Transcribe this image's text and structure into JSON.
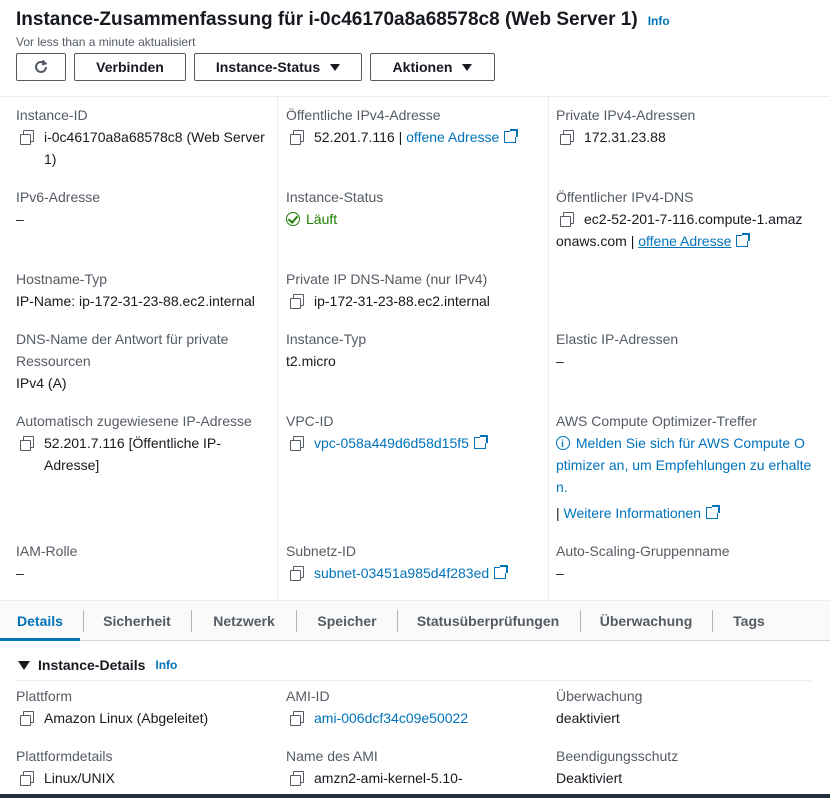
{
  "header": {
    "title": "Instance-Zusammenfassung für i-0c46170a8a68578c8 (Web Server 1)",
    "info": "Info",
    "subtitle": "Vor less than a minute aktualisiert",
    "buttons": {
      "connect": "Verbinden",
      "status": "Instance-Status",
      "actions": "Aktionen"
    }
  },
  "summary": {
    "instance_id": {
      "label": "Instance-ID",
      "value": "i-0c46170a8a68578c8 (Web Server 1)"
    },
    "public_ipv4": {
      "label": "Öffentliche IPv4-Adresse",
      "value": "52.201.7.116",
      "sep": " | ",
      "link": "offene Adresse"
    },
    "private_ipv4": {
      "label": "Private IPv4-Adressen",
      "value": "172.31.23.88"
    },
    "ipv6": {
      "label": "IPv6-Adresse",
      "value": "–"
    },
    "instance_state": {
      "label": "Instance-Status",
      "value": "Läuft"
    },
    "public_dns": {
      "label": "Öffentlicher IPv4-DNS",
      "value": "ec2-52-201-7-116.compute-1.amazonaws.com",
      "sep": " | ",
      "link": "offene Adresse"
    },
    "hostname_type": {
      "label": "Hostname-Typ",
      "value": "IP-Name: ip-172-31-23-88.ec2.internal"
    },
    "private_dns": {
      "label": "Private IP DNS-Name (nur IPv4)",
      "value": "ip-172-31-23-88.ec2.internal"
    },
    "answer_dns": {
      "label": "DNS-Name der Antwort für private Ressourcen",
      "value": "IPv4 (A)"
    },
    "instance_type": {
      "label": "Instance-Typ",
      "value": "t2.micro"
    },
    "elastic_ip": {
      "label": "Elastic IP-Adressen",
      "value": "–"
    },
    "auto_ip": {
      "label": "Automatisch zugewiesene IP-Adresse",
      "value": "52.201.7.116 [Öffentliche IP-Adresse]"
    },
    "vpc": {
      "label": "VPC-ID",
      "value": "vpc-058a449d6d58d15f5"
    },
    "optimizer": {
      "label": "AWS Compute Optimizer-Treffer",
      "value": "Melden Sie sich für AWS Compute Optimizer an, um Empfehlungen zu erhalten.",
      "sep": "| ",
      "link": "Weitere Informationen"
    },
    "iam": {
      "label": "IAM-Rolle",
      "value": "–"
    },
    "subnet": {
      "label": "Subnetz-ID",
      "value": "subnet-03451a985d4f283ed"
    },
    "asg": {
      "label": "Auto-Scaling-Gruppenname",
      "value": "–"
    }
  },
  "tabs": [
    "Details",
    "Sicherheit",
    "Netzwerk",
    "Speicher",
    "Statusüberprüfungen",
    "Überwachung",
    "Tags"
  ],
  "details": {
    "section_title": "Instance-Details",
    "info": "Info",
    "platform": {
      "label": "Plattform",
      "value": "Amazon Linux (Abgeleitet)"
    },
    "ami_id": {
      "label": "AMI-ID",
      "value": "ami-006dcf34c09e50022"
    },
    "monitoring": {
      "label": "Überwachung",
      "value": "deaktiviert"
    },
    "platform_details": {
      "label": "Plattformdetails",
      "value": "Linux/UNIX"
    },
    "ami_name": {
      "label": "Name des AMI",
      "value": "amzn2-ami-kernel-5.10-"
    },
    "termination": {
      "label": "Beendigungsschutz",
      "value": "Deaktiviert"
    }
  }
}
